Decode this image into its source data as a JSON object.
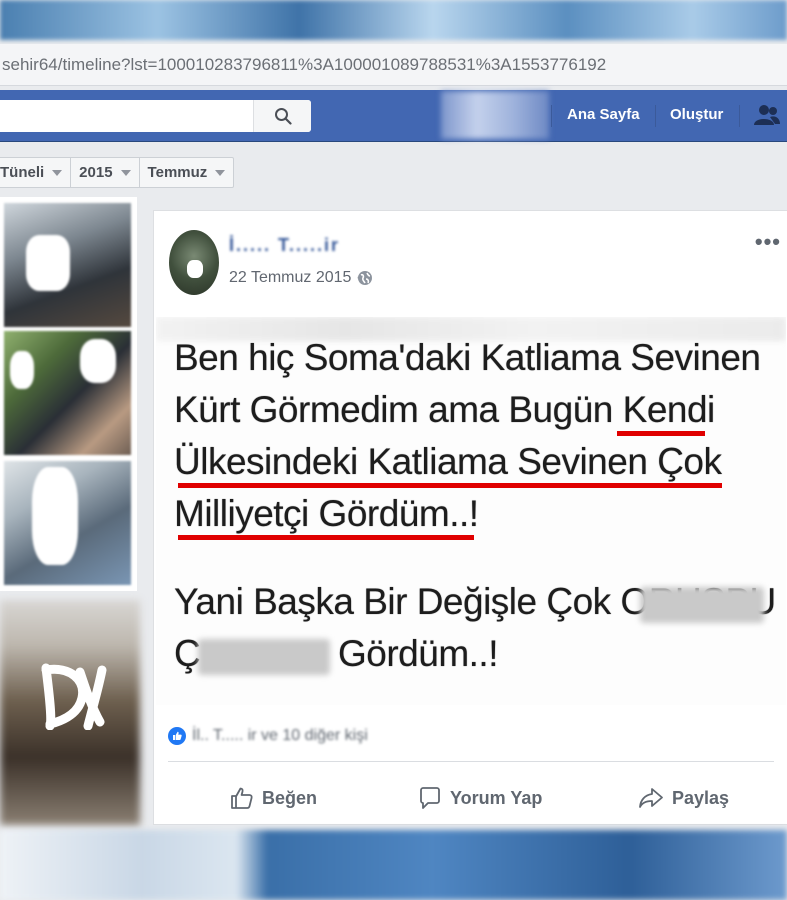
{
  "browser": {
    "url": "sehir64/timeline?lst=100010283796811%3A100001089788531%3A1553776192"
  },
  "fb_header": {
    "nav": [
      "Ana Sayfa",
      "Oluştur"
    ]
  },
  "timeline_filter": {
    "items": [
      "Tüneli",
      "2015",
      "Temmuz"
    ]
  },
  "post": {
    "author": "İ..... T.....ir",
    "date": "22 Temmuz 2015 ·",
    "image_text": {
      "line1": "Ben hiç Soma'daki Katliama Sevinen",
      "line2": "Kürt Görmedim ama Bugün Kendi",
      "line3": "Ülkesindeki Katliama Sevinen  Çok",
      "line4": "Milliyetçi Gördüm..!",
      "line5": "Yani Başka Bir Değişle Çok ORUSPU",
      "line6_start": "Ç",
      "line6_end": "Gördüm..!"
    },
    "likes_text": "İl.. T..... ir ve 10 diğer kişi",
    "actions": {
      "like": "Beğen",
      "comment": "Yorum Yap",
      "share": "Paylaş"
    }
  },
  "colors": {
    "fb_blue": "#4267b2",
    "link_blue": "#365899",
    "underline_red": "#e00000"
  },
  "icons": [
    "search-icon",
    "friends-icon",
    "globe-icon",
    "more-icon",
    "like-badge-icon",
    "thumbs-up-icon",
    "comment-icon",
    "share-icon"
  ]
}
